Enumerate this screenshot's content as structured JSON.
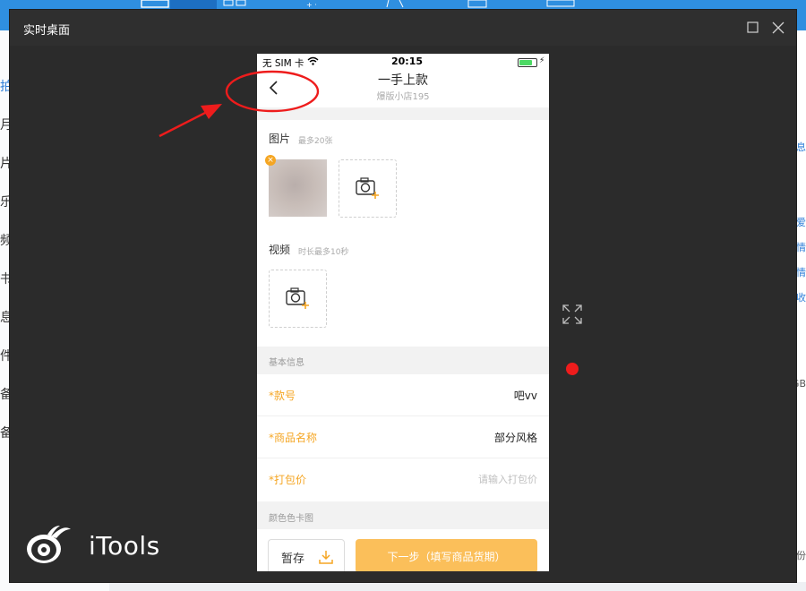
{
  "background_app": {
    "left_menu_fragments": [
      "拍",
      "月",
      "片",
      "乐",
      "频",
      "书",
      "息",
      "件",
      "备",
      "备"
    ],
    "right_fragments": [
      "息",
      "爱",
      "情",
      "情",
      "收"
    ],
    "right_storage_fragment": "GB",
    "right_bottom_fragment": "份"
  },
  "window": {
    "title": "实时桌面",
    "maximize_icon": "maximize-icon",
    "close_icon": "close-icon",
    "logo_text": "iTools"
  },
  "phone": {
    "status": {
      "carrier": "无 SIM 卡",
      "time": "20:15",
      "bolt": "⚡"
    },
    "nav": {
      "title": "一手上款",
      "subtitle": "爆版小店195"
    },
    "images": {
      "label": "图片",
      "hint": "最多20张",
      "remove_mark": "×"
    },
    "video": {
      "label": "视频",
      "hint": "时长最多10秒"
    },
    "basic_info": {
      "header": "基本信息",
      "fields": [
        {
          "label": "*款号",
          "value": "吧vv",
          "placeholder": ""
        },
        {
          "label": "*商品名称",
          "value": "部分风格",
          "placeholder": ""
        },
        {
          "label": "*打包价",
          "value": "",
          "placeholder": "请输入打包价"
        }
      ]
    },
    "color_card": {
      "header": "颜色色卡图"
    },
    "footer": {
      "save_label": "暂存",
      "next_label": "下一步（填写商品货期）"
    }
  },
  "colors": {
    "accent": "#f5a623",
    "next_button": "#fbbf5a",
    "annotation_red": "#ee1c1c",
    "window_bg": "#2b2b2b",
    "app_blue": "#2f8fe0"
  }
}
